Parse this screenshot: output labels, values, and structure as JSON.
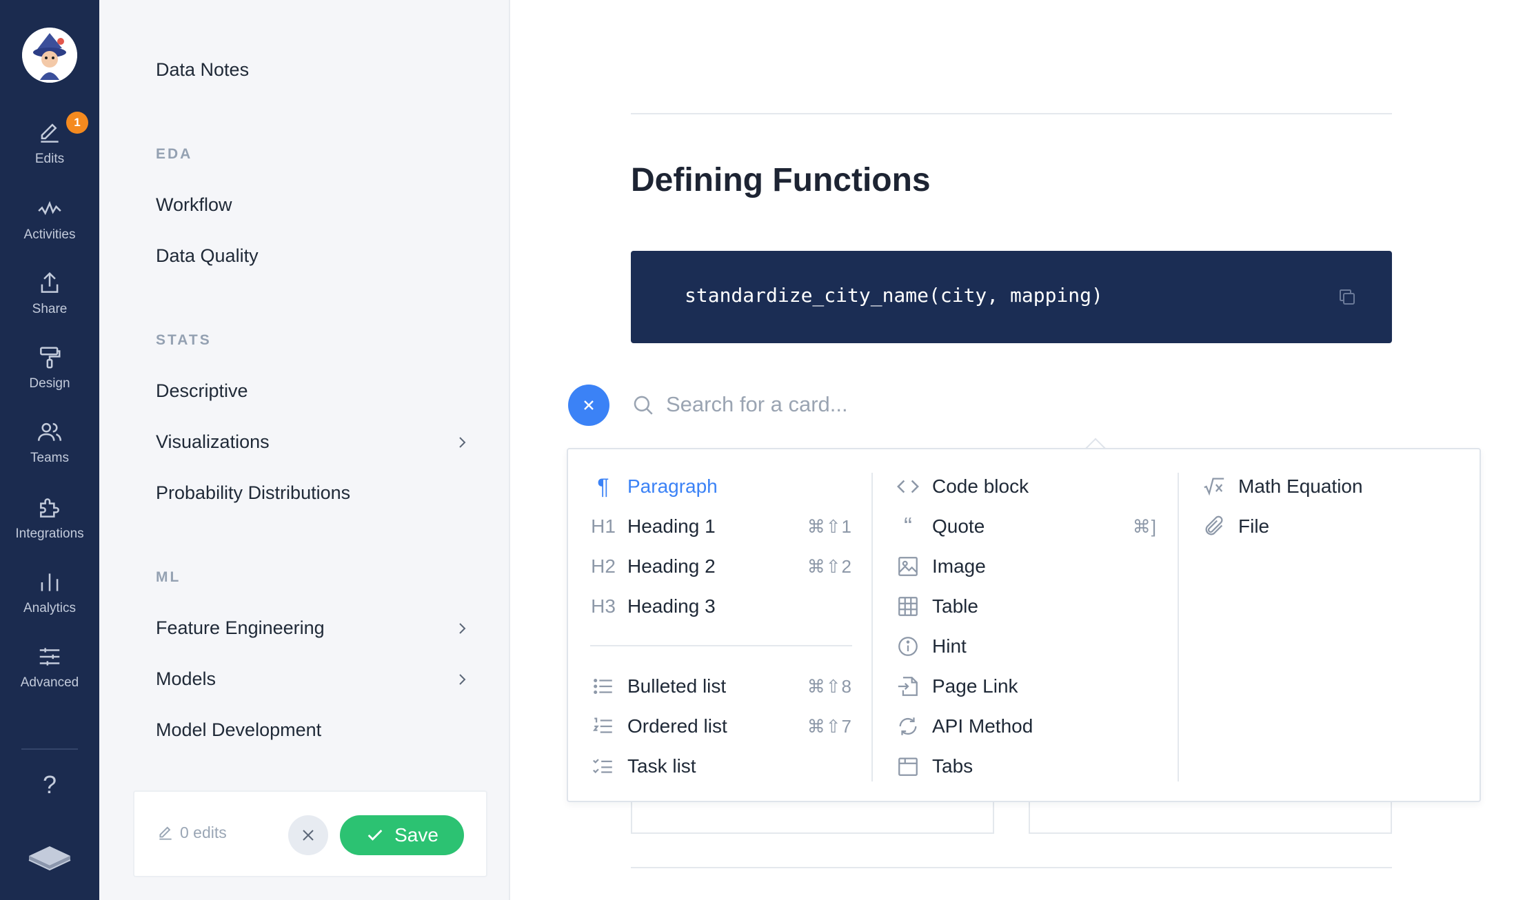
{
  "rail": {
    "items": [
      {
        "label": "Edits",
        "icon": "pencil-icon"
      },
      {
        "label": "Activities",
        "icon": "activity-icon"
      },
      {
        "label": "Share",
        "icon": "share-icon"
      },
      {
        "label": "Design",
        "icon": "paint-roller-icon"
      },
      {
        "label": "Teams",
        "icon": "users-icon"
      },
      {
        "label": "Integrations",
        "icon": "puzzle-icon"
      },
      {
        "label": "Analytics",
        "icon": "bar-chart-icon"
      },
      {
        "label": "Advanced",
        "icon": "sliders-icon"
      }
    ],
    "edits_badge": "1",
    "help": "?"
  },
  "sidebar": {
    "top_item": "Data Notes",
    "groups": [
      {
        "title": "EDA",
        "items": [
          "Workflow",
          "Data Quality"
        ]
      },
      {
        "title": "STATS",
        "items": [
          "Descriptive",
          "Visualizations",
          "Probability Distributions"
        ]
      },
      {
        "title": "ML",
        "items": [
          "Feature Engineering",
          "Models",
          "Model Development"
        ]
      }
    ],
    "edits_count": "0 edits",
    "save_label": "Save"
  },
  "main": {
    "title": "Defining Functions",
    "code": "standardize_city_name(city, mapping)",
    "search_placeholder": "Search for a card..."
  },
  "menu": {
    "col1": [
      {
        "label": "Paragraph",
        "icon": "¶",
        "shortcut": ""
      },
      {
        "label": "Heading 1",
        "icon": "H1",
        "shortcut": "⌘⇧1"
      },
      {
        "label": "Heading 2",
        "icon": "H2",
        "shortcut": "⌘⇧2"
      },
      {
        "label": "Heading 3",
        "icon": "H3",
        "shortcut": ""
      },
      {
        "label": "Bulleted list",
        "icon": "bulleted-list-icon",
        "shortcut": "⌘⇧8"
      },
      {
        "label": "Ordered list",
        "icon": "ordered-list-icon",
        "shortcut": "⌘⇧7"
      },
      {
        "label": "Task list",
        "icon": "task-list-icon",
        "shortcut": ""
      }
    ],
    "col2": [
      {
        "label": "Code block",
        "icon": "code-icon",
        "shortcut": ""
      },
      {
        "label": "Quote",
        "icon": "quote-icon",
        "shortcut": "⌘]"
      },
      {
        "label": "Image",
        "icon": "image-icon",
        "shortcut": ""
      },
      {
        "label": "Table",
        "icon": "table-icon",
        "shortcut": ""
      },
      {
        "label": "Hint",
        "icon": "info-icon",
        "shortcut": ""
      },
      {
        "label": "Page Link",
        "icon": "page-link-icon",
        "shortcut": ""
      },
      {
        "label": "API Method",
        "icon": "api-method-icon",
        "shortcut": ""
      },
      {
        "label": "Tabs",
        "icon": "tabs-icon",
        "shortcut": ""
      }
    ],
    "col3": [
      {
        "label": "Math Equation",
        "icon": "math-equation-icon"
      },
      {
        "label": "File",
        "icon": "paperclip-icon"
      }
    ]
  },
  "colors": {
    "rail_bg": "#1b2b4f",
    "accent_blue": "#3b82f6",
    "save_green": "#2cc272",
    "badge_orange": "#f58a1f",
    "code_bg": "#1b2d54"
  }
}
